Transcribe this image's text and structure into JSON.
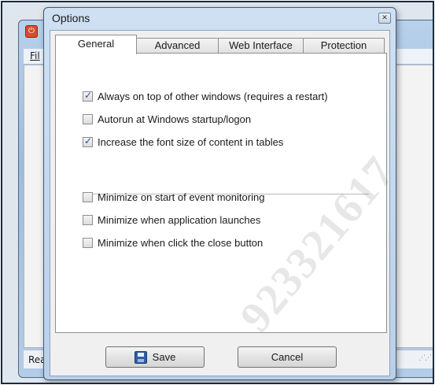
{
  "background_window": {
    "menu_fragment": "Fil",
    "status_fragment": "Rea"
  },
  "dialog": {
    "title": "Options",
    "close_glyph": "✕"
  },
  "tabs": [
    {
      "label": "General",
      "active": true
    },
    {
      "label": "Advanced",
      "active": false
    },
    {
      "label": "Web Interface",
      "active": false
    },
    {
      "label": "Protection",
      "active": false
    }
  ],
  "general": {
    "options_group_1": [
      {
        "label": "Always on top of other windows (requires a restart)",
        "checked": true
      },
      {
        "label": "Autorun at Windows startup/logon",
        "checked": false
      },
      {
        "label": "Increase the font size of content in tables",
        "checked": true
      }
    ],
    "options_group_2": [
      {
        "label": "Minimize on start of event monitoring",
        "checked": false
      },
      {
        "label": "Minimize when application launches",
        "checked": false
      },
      {
        "label": "Minimize when click the close button",
        "checked": false
      }
    ]
  },
  "buttons": {
    "save_label": "Save",
    "cancel_label": "Cancel"
  },
  "watermark_text": "923321617",
  "icons": {
    "save": "save-disk-icon",
    "close": "close-icon",
    "app": "app-icon"
  }
}
